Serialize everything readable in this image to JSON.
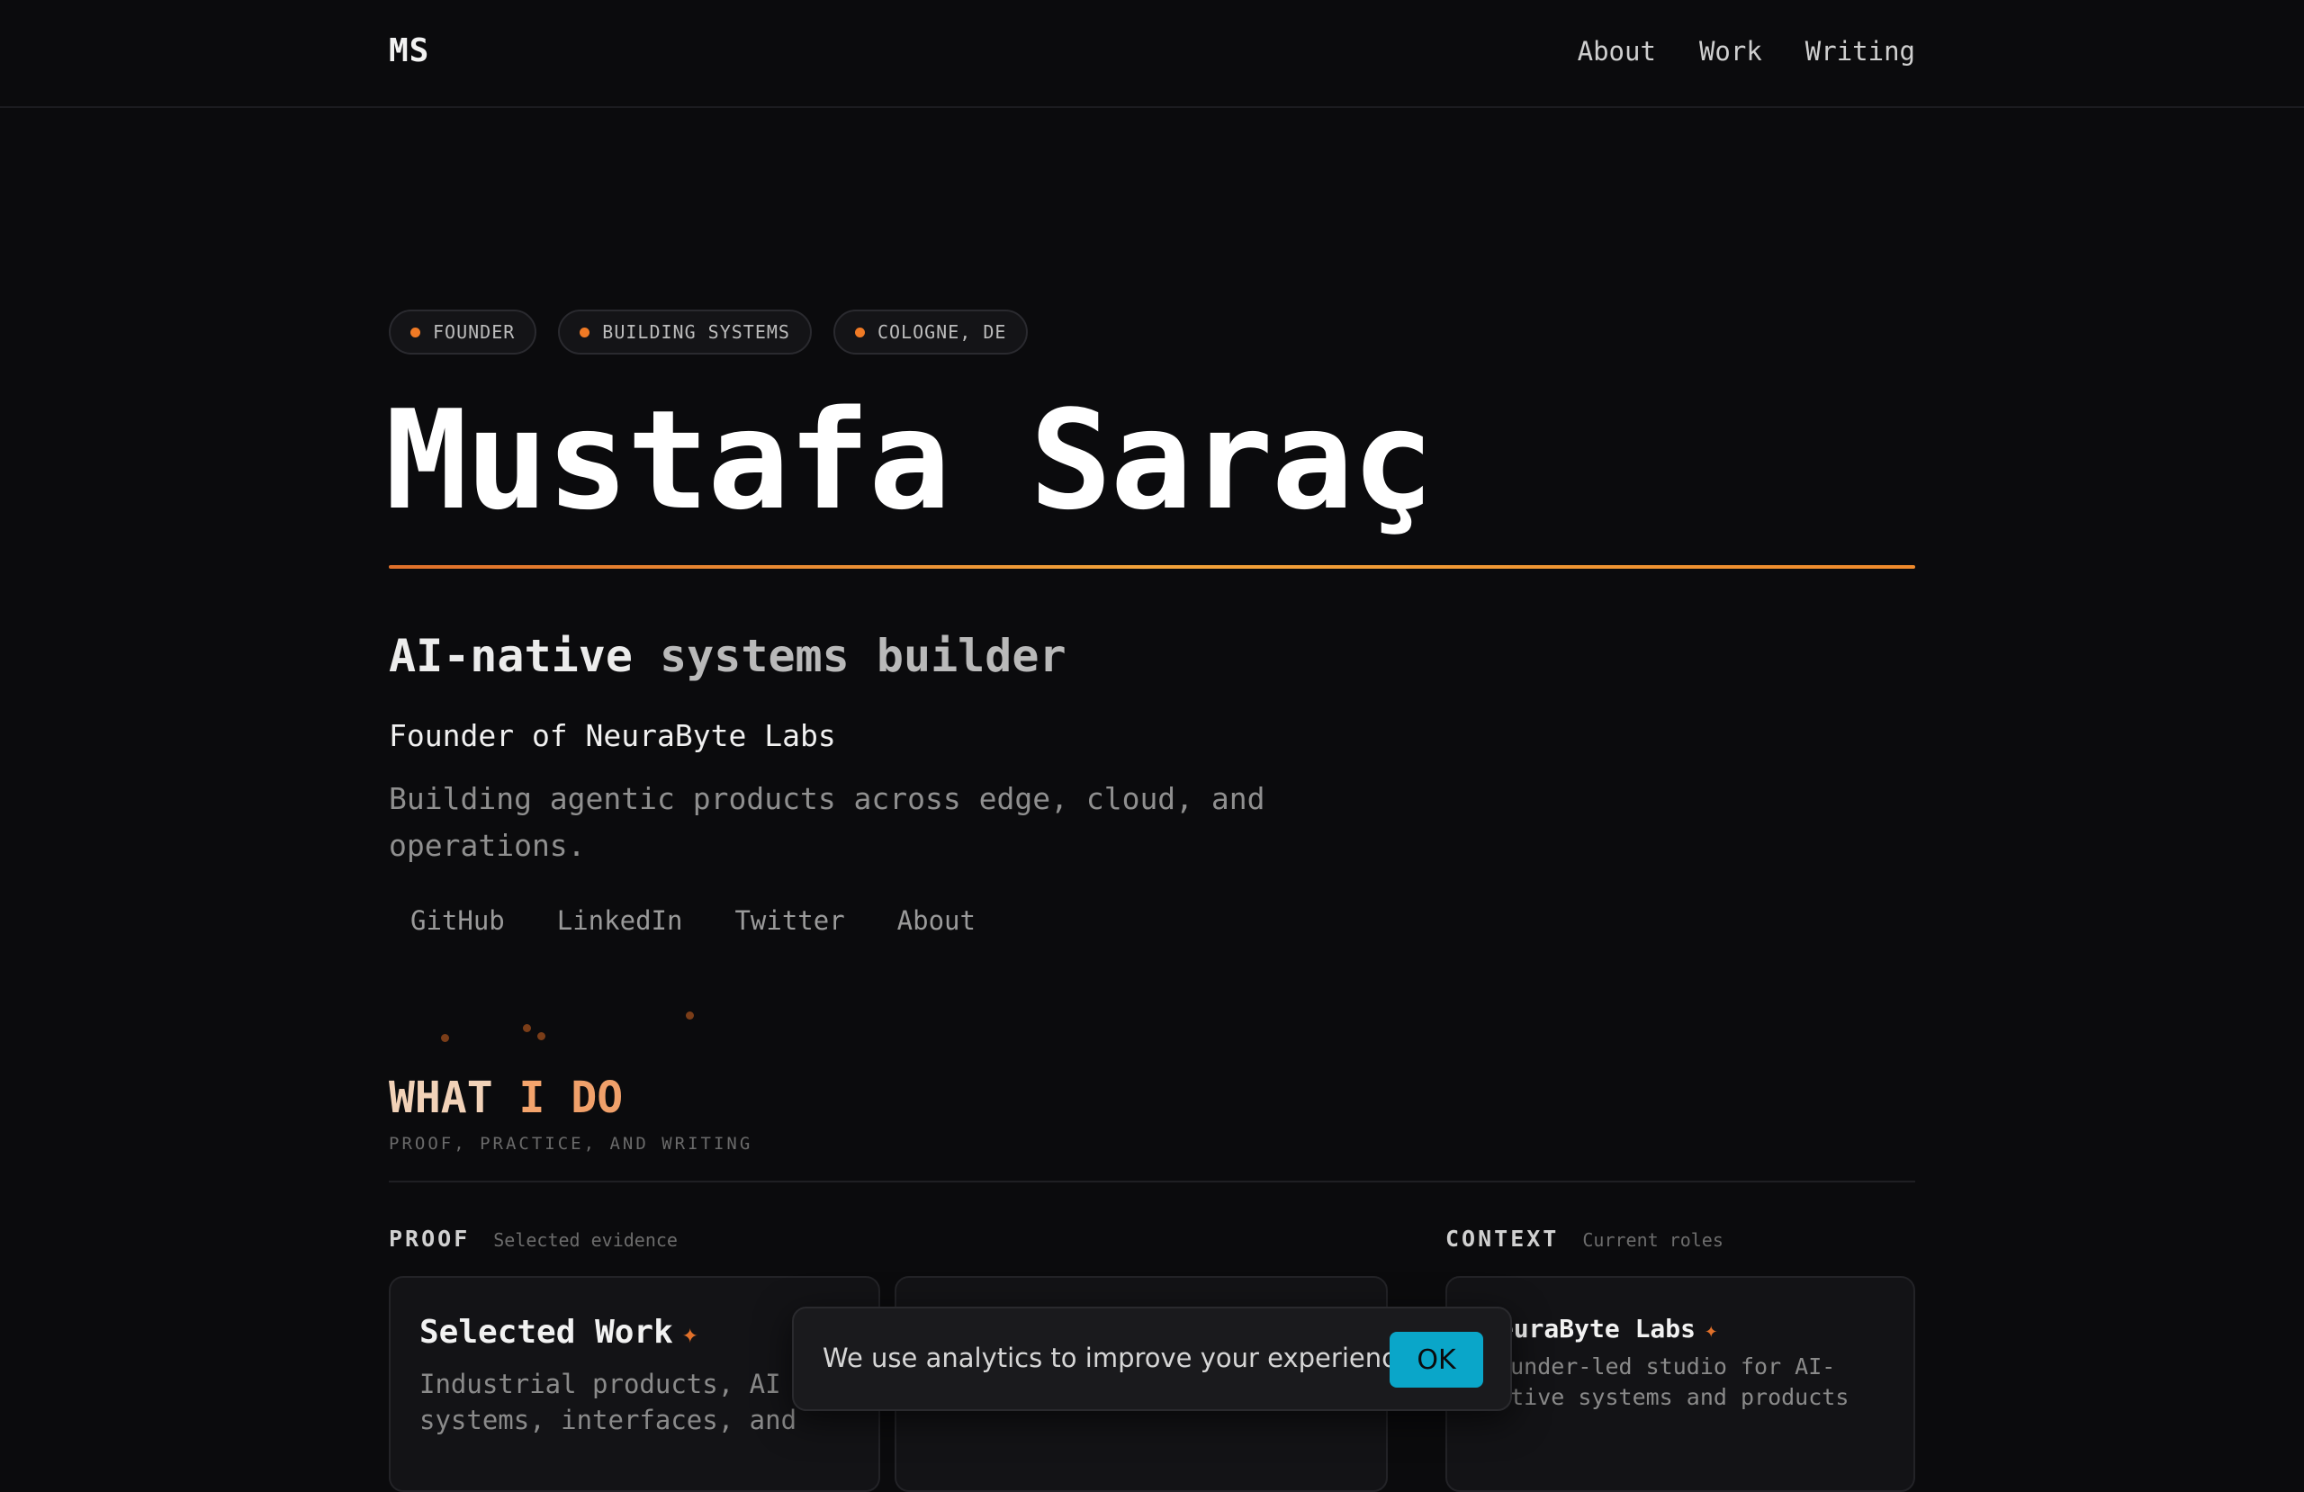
{
  "header": {
    "logo": "MS",
    "nav": [
      "About",
      "Work",
      "Writing"
    ]
  },
  "hero": {
    "tags": [
      "FOUNDER",
      "BUILDING SYSTEMS",
      "COLOGNE, DE"
    ],
    "name": "Mustafa Saraç",
    "subtitle_part1": "AI-native",
    "subtitle_part2": "systems builder",
    "founder_line": "Founder of NeuraByte Labs",
    "description": "Building agentic products across edge, cloud, and operations.",
    "links": [
      "GitHub",
      "LinkedIn",
      "Twitter",
      "About"
    ]
  },
  "what_i_do": {
    "title_part1": "WHAT",
    "title_part2": "I",
    "title_part3": "DO",
    "subtitle": "PROOF, PRACTICE, AND WRITING",
    "proof": {
      "heading": "PROOF",
      "subheading": "Selected evidence",
      "card1_title": "Selected Work",
      "card1_body": "Industrial products, AI systems, interfaces, and"
    },
    "context": {
      "heading": "CONTEXT",
      "subheading": "Current roles",
      "card_title": "NeuraByte Labs",
      "card_body": "Founder-led studio for AI-native systems and products"
    }
  },
  "cookie_banner": {
    "message": "We use analytics to improve your experience.",
    "ok_label": "OK"
  },
  "icons": {
    "tag_dot": "dot-icon",
    "card_star": "sparkle-icon"
  },
  "colors": {
    "accent": "#f07a25",
    "background": "#0b0b0d",
    "cookie_button": "#0aa6c9"
  }
}
